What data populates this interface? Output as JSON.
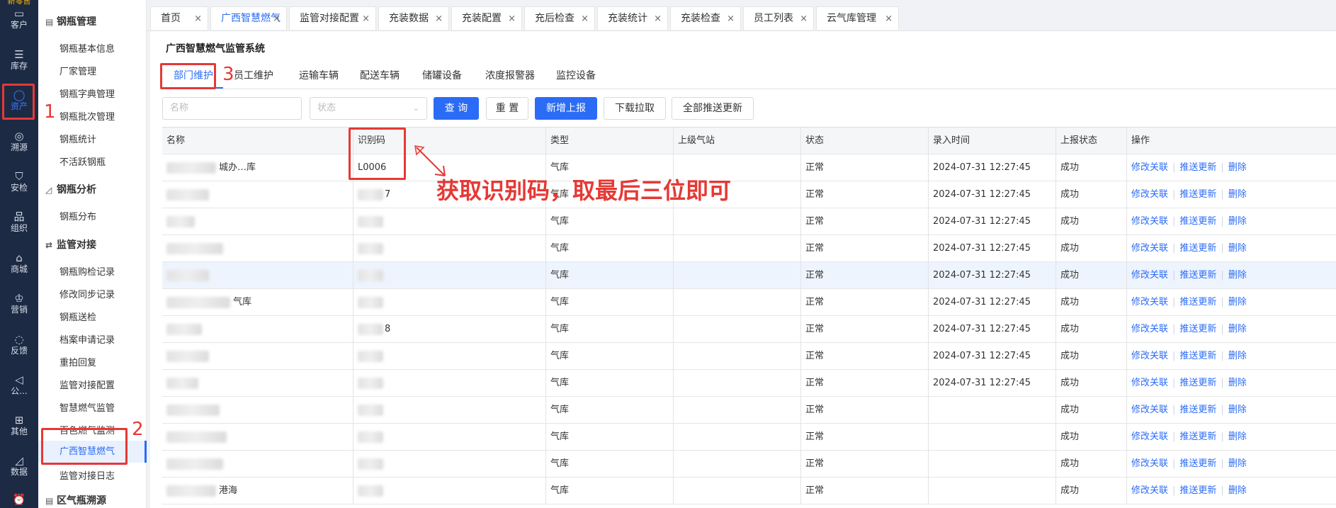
{
  "rail": {
    "top_text": "新零售",
    "items": [
      {
        "label": "客户",
        "icon": "id-card-icon"
      },
      {
        "label": "库存",
        "icon": "list-icon"
      },
      {
        "label": "资产",
        "icon": "bulb-icon"
      },
      {
        "label": "溯源",
        "icon": "compass-icon"
      },
      {
        "label": "安检",
        "icon": "shield-icon"
      },
      {
        "label": "组织",
        "icon": "org-icon"
      },
      {
        "label": "商城",
        "icon": "store-icon"
      },
      {
        "label": "营销",
        "icon": "trophy-icon"
      },
      {
        "label": "反馈",
        "icon": "chat-icon"
      },
      {
        "label": "公...",
        "icon": "megaphone-icon"
      },
      {
        "label": "其他",
        "icon": "grid-icon"
      },
      {
        "label": "数据",
        "icon": "chart-icon"
      }
    ]
  },
  "submenu": {
    "groups": [
      {
        "title": "钢瓶管理",
        "items": [
          "钢瓶基本信息",
          "厂家管理",
          "钢瓶字典管理",
          "钢瓶批次管理",
          "钢瓶统计",
          "不活跃钢瓶"
        ]
      },
      {
        "title": "钢瓶分析",
        "items": [
          "钢瓶分布"
        ]
      },
      {
        "title": "监管对接",
        "items": [
          "钢瓶购检记录",
          "修改同步记录",
          "钢瓶送检",
          "档案申请记录",
          "重拍回复",
          "监管对接配置",
          "智慧燃气监管",
          "百色燃气监测",
          "广西智慧燃气",
          "监管对接日志"
        ]
      },
      {
        "title": "区气瓶溯源",
        "items": []
      }
    ]
  },
  "tabs": [
    "首页",
    "广西智慧燃气",
    "监管对接配置",
    "充装数据",
    "充装配置",
    "充后检查",
    "充装统计",
    "充装检查",
    "员工列表",
    "云气库管理"
  ],
  "active_tab": "广西智慧燃气",
  "page_title": "广西智慧燃气监管系统",
  "subtabs": [
    "部门维护",
    "员工维护",
    "运输车辆",
    "配送车辆",
    "储罐设备",
    "浓度报警器",
    "监控设备"
  ],
  "filters": {
    "name_placeholder": "名称",
    "status_placeholder": "状态"
  },
  "buttons": {
    "query": "查 询",
    "reset": "重 置",
    "add": "新增上报",
    "download": "下载拉取",
    "push_all": "全部推送更新"
  },
  "table": {
    "columns": [
      "名称",
      "识别码",
      "类型",
      "上级气站",
      "状态",
      "录入时间",
      "上报状态",
      "操作"
    ],
    "actions": [
      "修改关联",
      "推送更新",
      "删除"
    ],
    "rows": [
      {
        "name": "城办…库",
        "code": "L0006",
        "type": "气库",
        "parent": "",
        "status": "正常",
        "time": "2024-07-31 12:27:45",
        "report": "成功"
      },
      {
        "name": "",
        "code": "7",
        "type": "气库",
        "parent": "",
        "status": "正常",
        "time": "2024-07-31 12:27:45",
        "report": "成功"
      },
      {
        "name": "",
        "code": "",
        "type": "气库",
        "parent": "",
        "status": "正常",
        "time": "2024-07-31 12:27:45",
        "report": "成功"
      },
      {
        "name": "",
        "code": "",
        "type": "气库",
        "parent": "",
        "status": "正常",
        "time": "2024-07-31 12:27:45",
        "report": "成功"
      },
      {
        "name": "",
        "code": "",
        "type": "气库",
        "parent": "",
        "status": "正常",
        "time": "2024-07-31 12:27:45",
        "report": "成功"
      },
      {
        "name": "气库",
        "code": "",
        "type": "气库",
        "parent": "",
        "status": "正常",
        "time": "2024-07-31 12:27:45",
        "report": "成功"
      },
      {
        "name": "",
        "code": "8",
        "type": "气库",
        "parent": "",
        "status": "正常",
        "time": "2024-07-31 12:27:45",
        "report": "成功"
      },
      {
        "name": "",
        "code": "",
        "type": "气库",
        "parent": "",
        "status": "正常",
        "time": "2024-07-31 12:27:45",
        "report": "成功"
      },
      {
        "name": "",
        "code": "",
        "type": "气库",
        "parent": "",
        "status": "正常",
        "time": "2024-07-31 12:27:45",
        "report": "成功"
      },
      {
        "name": "",
        "code": "",
        "type": "气库",
        "parent": "",
        "status": "正常",
        "time": "",
        "report": "成功"
      },
      {
        "name": "",
        "code": "",
        "type": "气库",
        "parent": "",
        "status": "正常",
        "time": "",
        "report": "成功"
      },
      {
        "name": "",
        "code": "",
        "type": "气库",
        "parent": "",
        "status": "正常",
        "time": "",
        "report": "成功"
      },
      {
        "name": "港海",
        "code": "",
        "type": "气库",
        "parent": "",
        "status": "正常",
        "time": "",
        "report": "成功"
      }
    ]
  },
  "annotations": {
    "n1": "1",
    "n2": "2",
    "n3": "3",
    "text": "获取识别码，取最后三位即可"
  },
  "colors": {
    "primary": "#2b6cf6",
    "rail_bg": "#1d2a43",
    "annotation": "#e53935"
  }
}
